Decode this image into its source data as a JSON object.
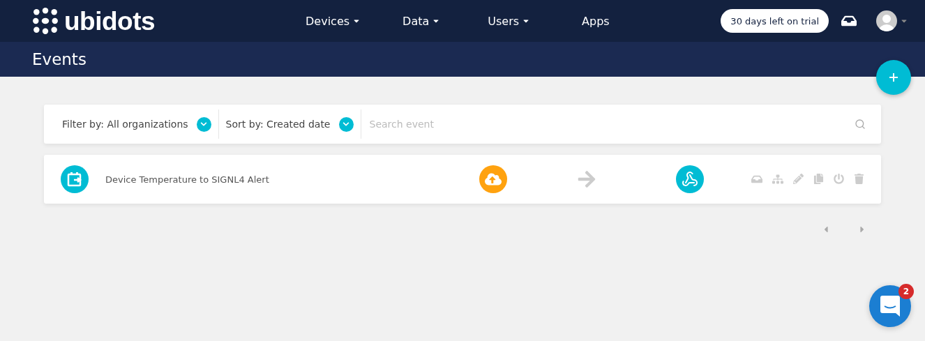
{
  "logo": {
    "text": "ubidots"
  },
  "nav": [
    {
      "label": "Devices",
      "dropdown": true
    },
    {
      "label": "Data",
      "dropdown": true
    },
    {
      "label": "Users",
      "dropdown": true
    },
    {
      "label": "Apps",
      "dropdown": false
    }
  ],
  "trial_badge": "30 days left on trial",
  "page_title": "Events",
  "toolbar": {
    "filter": "Filter by: All organizations",
    "sort": "Sort by: Created date",
    "search": {
      "placeholder": "Search event"
    }
  },
  "events": [
    {
      "name": "Device Temperature to SIGNL4 Alert"
    }
  ],
  "chat": {
    "badge": "2"
  }
}
